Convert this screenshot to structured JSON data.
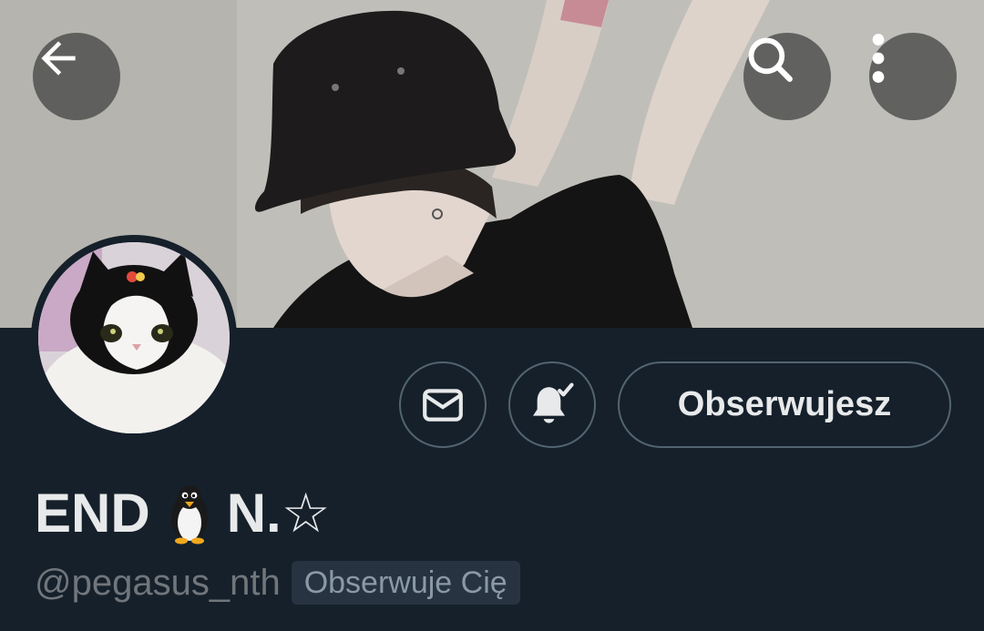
{
  "header": {
    "back_icon": "arrow-left-icon",
    "search_icon": "search-icon",
    "more_icon": "more-vertical-icon",
    "banner_description_icon": "banner-photo"
  },
  "profile": {
    "avatar_icon": "avatar-cat-photo",
    "name_prefix": "END",
    "name_emoji_icon": "penguin-emoji",
    "name_suffix": "N.☆",
    "handle": "@pegasus_nth",
    "follows_you_badge": "Obserwuje Cię"
  },
  "actions": {
    "message_icon": "envelope-icon",
    "notifications_icon": "bell-check-icon",
    "follow_label": "Obserwujesz"
  },
  "colors": {
    "background": "#15202b",
    "text_primary": "#e7e9ea",
    "text_secondary": "#71767b",
    "button_border": "#536471",
    "badge_bg": "#273340"
  }
}
